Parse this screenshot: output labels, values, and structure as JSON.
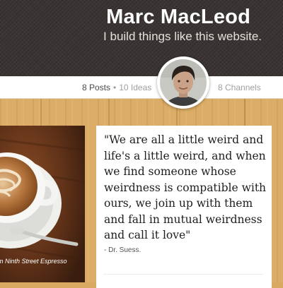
{
  "header": {
    "name": "Marc MacLeod",
    "tagline": "I build things like this website."
  },
  "stats": {
    "posts": "8 Posts",
    "separator": "•",
    "ideas": "10 Ideas",
    "channels": "8 Channels"
  },
  "photo_post": {
    "caption": "m Ninth Street Espresso"
  },
  "quote_post": {
    "text": "\"We are all a little weird and life's a little weird, and when we find someone whose weirdness is compatible with ours, we join up with them and fall in mutual weirdness and call it love\"",
    "author": "- Dr. Suess."
  },
  "colors": {
    "header_bg": "#3a3433",
    "wood": "#dcad66",
    "card_bg": "#ffffff"
  }
}
